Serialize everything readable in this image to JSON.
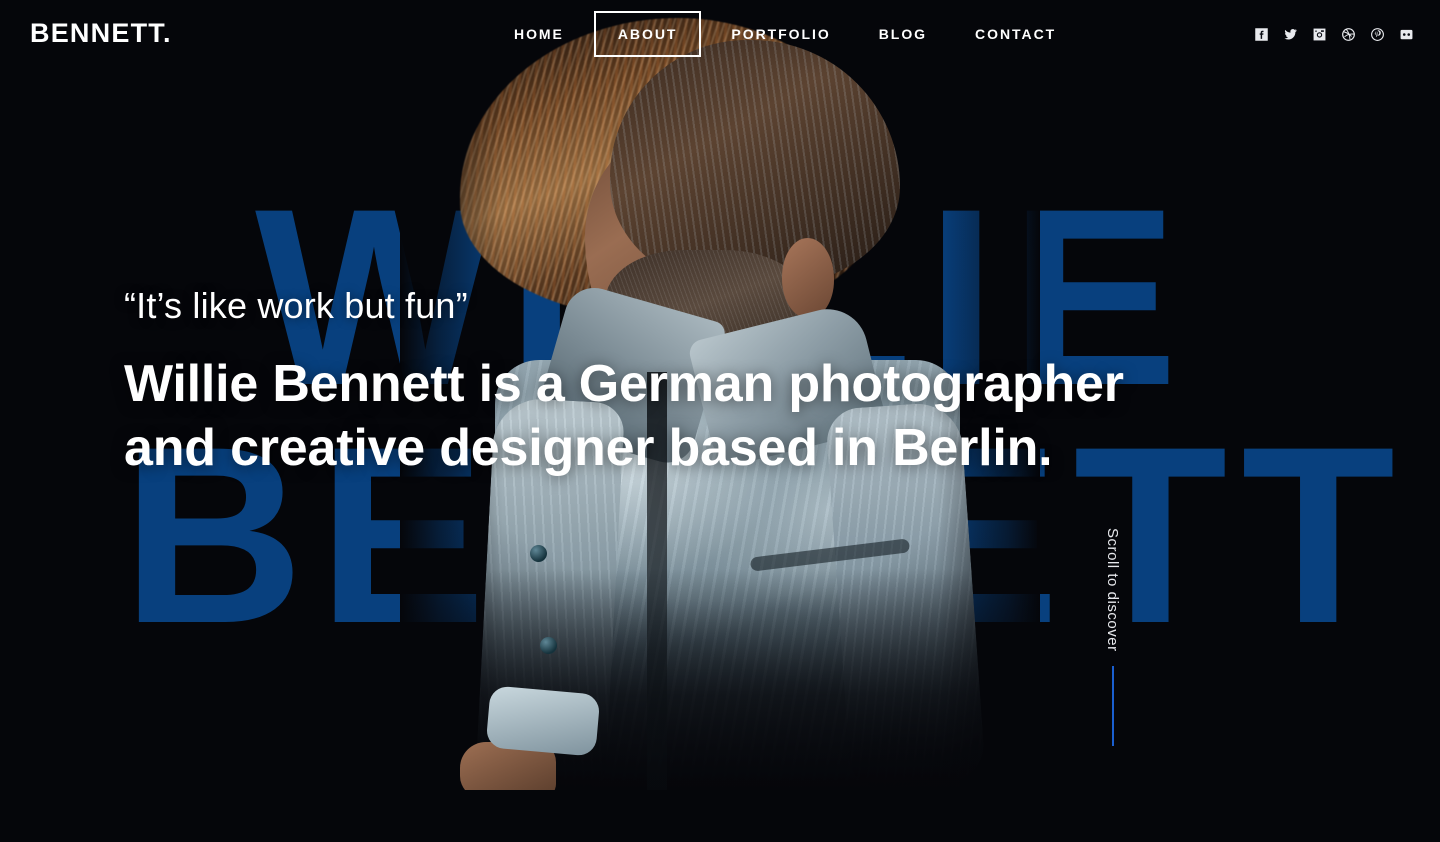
{
  "theme": {
    "background": "#05060a",
    "accent_blue": "#08407e",
    "scroll_line_blue": "#1a5fd0",
    "text_white": "#ffffff"
  },
  "header": {
    "brand": "BENNETT.",
    "nav": [
      {
        "label": "HOME",
        "active": false,
        "name": "nav-item-home"
      },
      {
        "label": "ABOUT",
        "active": true,
        "name": "nav-item-about"
      },
      {
        "label": "PORTFOLIO",
        "active": false,
        "name": "nav-item-portfolio"
      },
      {
        "label": "BLOG",
        "active": false,
        "name": "nav-item-blog"
      },
      {
        "label": "CONTACT",
        "active": false,
        "name": "nav-item-contact"
      }
    ],
    "socials": [
      {
        "icon": "facebook-icon",
        "label": "Facebook"
      },
      {
        "icon": "twitter-icon",
        "label": "Twitter"
      },
      {
        "icon": "instagram-icon",
        "label": "Instagram"
      },
      {
        "icon": "dribbble-icon",
        "label": "Dribbble"
      },
      {
        "icon": "pinterest-icon",
        "label": "Pinterest"
      },
      {
        "icon": "flickr-icon",
        "label": "Flickr"
      }
    ]
  },
  "hero": {
    "quote": "“It’s like work but fun”",
    "headline_line1": "Willie Bennett is a German photographer",
    "headline_line2": "and creative designer based in Berlin.",
    "background_type_line1": "WILLIE",
    "background_type_line2": "BENNETT"
  },
  "scroll_indicator": {
    "label": "Scroll to discover"
  }
}
